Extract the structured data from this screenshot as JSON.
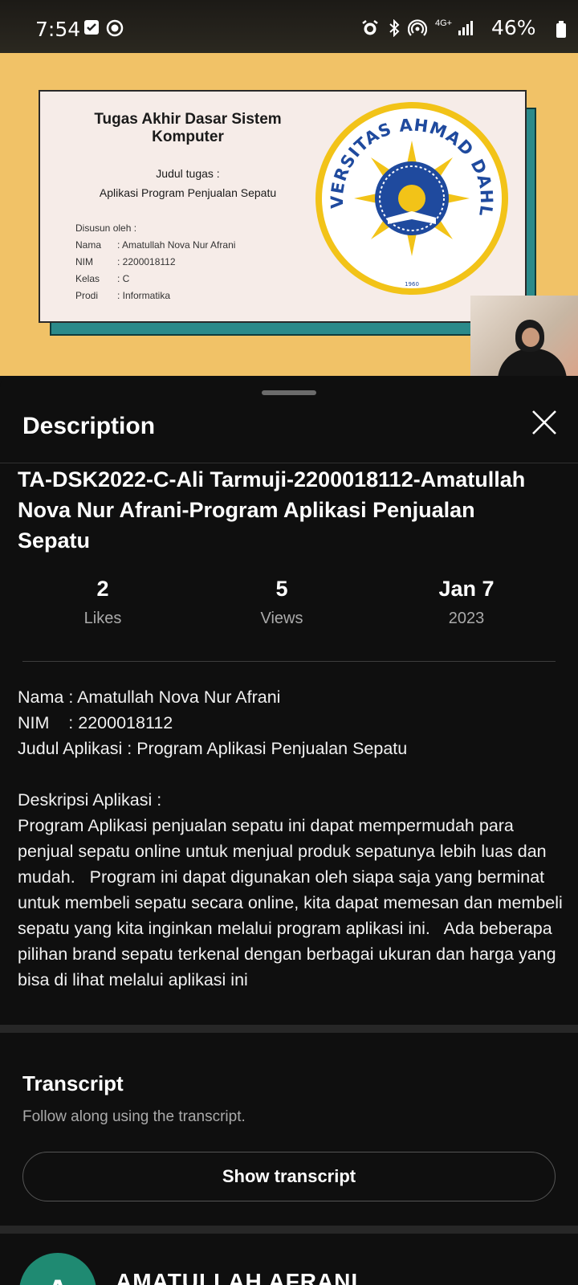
{
  "status_bar": {
    "time": "7:54",
    "battery": "46%",
    "network": "4G+"
  },
  "slide": {
    "title": "Tugas Akhir Dasar Sistem Komputer",
    "subtitle_label": "Judul tugas :",
    "subtitle_value": "Aplikasi Program Penjualan Sepatu",
    "info": {
      "heading": "Disusun oleh :",
      "nama_label": "Nama",
      "nama_value": ": Amatullah Nova Nur Afrani",
      "nim_label": "NIM",
      "nim_value": ": 2200018112",
      "kelas_label": "Kelas",
      "kelas_value": ": C",
      "prodi_label": "Prodi",
      "prodi_value": ": Informatika"
    },
    "logo_text": "UNIVERSITAS AHMAD DAHLAN",
    "logo_year": "1960"
  },
  "sheet": {
    "title": "Description",
    "video_title": "TA-DSK2022-C-Ali Tarmuji-2200018112-Amatullah Nova Nur Afrani-Program Aplikasi Penjualan Sepatu",
    "stats": {
      "likes_value": "2",
      "likes_label": "Likes",
      "views_value": "5",
      "views_label": "Views",
      "date_value": "Jan 7",
      "date_year": "2023"
    },
    "description": "Nama : Amatullah Nova Nur Afrani\nNIM    : 2200018112\nJudul Aplikasi : Program Aplikasi Penjualan Sepatu\n\nDeskripsi Aplikasi :\nProgram Aplikasi penjualan sepatu ini dapat mempermudah para penjual sepatu online untuk menjual produk sepatunya lebih luas dan mudah.   Program ini dapat digunakan oleh siapa saja yang berminat untuk membeli sepatu secara online, kita dapat memesan dan membeli sepatu yang kita inginkan melalui program aplikasi ini.   Ada beberapa pilihan brand sepatu terkenal dengan berbagai ukuran dan harga yang bisa di lihat melalui aplikasi ini",
    "transcript": {
      "title": "Transcript",
      "subtitle": "Follow along using the transcript.",
      "button": "Show transcript"
    },
    "channel": {
      "avatar_letter": "A",
      "name": "AMATULLAH AFRANI"
    }
  },
  "colors": {
    "video_bg": "#f1c267",
    "sheet_bg": "#0f0f0f",
    "teal": "#2b8a8a",
    "logo_blue": "#1f4a9e",
    "logo_gold": "#f2c318"
  }
}
